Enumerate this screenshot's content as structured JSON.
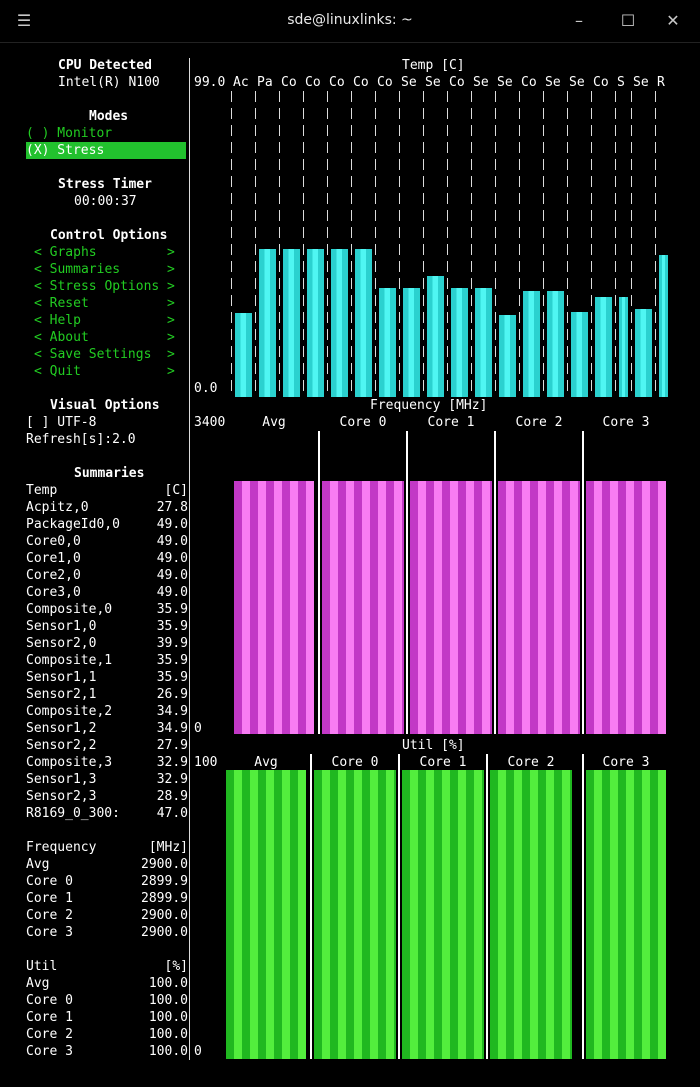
{
  "window": {
    "title": "sde@linuxlinks: ~",
    "menu_icon": "hamburger-icon",
    "min_icon": "minimize-icon",
    "max_icon": "maximize-icon",
    "close_icon": "close-icon"
  },
  "cpu": {
    "heading": "CPU Detected",
    "model": "Intel(R) N100"
  },
  "modes": {
    "heading": "Modes",
    "monitor": "( ) Monitor",
    "stress_mark": "(X)",
    "stress_label": " Stress"
  },
  "timer": {
    "heading": "Stress Timer",
    "value": "00:00:37"
  },
  "control": {
    "heading": "Control Options",
    "items": [
      "< Graphs         >",
      "< Summaries      >",
      "< Stress Options >",
      "< Reset          >",
      "< Help           >",
      "< About          >",
      "< Save Settings  >",
      "< Quit           >"
    ]
  },
  "visual": {
    "heading": "Visual Options",
    "encoding": "[ ] UTF-8",
    "refresh": "Refresh[s]:2.0"
  },
  "summaries": {
    "heading": "Summaries",
    "temp": {
      "header": "Temp",
      "unit": "[C]",
      "rows": [
        [
          "Acpitz,0",
          "27.8"
        ],
        [
          "PackageId0,0",
          "49.0"
        ],
        [
          "Core0,0",
          "49.0"
        ],
        [
          "Core1,0",
          "49.0"
        ],
        [
          "Core2,0",
          "49.0"
        ],
        [
          "Core3,0",
          "49.0"
        ],
        [
          "Composite,0",
          "35.9"
        ],
        [
          "Sensor1,0",
          "35.9"
        ],
        [
          "Sensor2,0",
          "39.9"
        ],
        [
          "Composite,1",
          "35.9"
        ],
        [
          "Sensor1,1",
          "35.9"
        ],
        [
          "Sensor2,1",
          "26.9"
        ],
        [
          "Composite,2",
          "34.9"
        ],
        [
          "Sensor1,2",
          "34.9"
        ],
        [
          "Sensor2,2",
          "27.9"
        ],
        [
          "Composite,3",
          "32.9"
        ],
        [
          "Sensor1,3",
          "32.9"
        ],
        [
          "Sensor2,3",
          "28.9"
        ],
        [
          "R8169_0_300:",
          "47.0"
        ]
      ]
    },
    "freq": {
      "header": "Frequency",
      "unit": "[MHz]",
      "rows": [
        [
          "Avg",
          "2900.0"
        ],
        [
          "Core 0",
          "2899.9"
        ],
        [
          "Core 1",
          "2899.9"
        ],
        [
          "Core 2",
          "2900.0"
        ],
        [
          "Core 3",
          "2900.0"
        ]
      ]
    },
    "util": {
      "header": "Util",
      "unit": "[%]",
      "rows": [
        [
          "Avg",
          "100.0"
        ],
        [
          "Core 0",
          "100.0"
        ],
        [
          "Core 1",
          "100.0"
        ],
        [
          "Core 2",
          "100.0"
        ],
        [
          "Core 3",
          "100.0"
        ]
      ]
    }
  },
  "temp_graph": {
    "title": "Temp [C]",
    "max": "99.0",
    "min": "0.0",
    "max_value": 99.0,
    "sensor_labels": [
      "Ac",
      "Pa",
      "Co",
      "Co",
      "Co",
      "Co",
      "Co",
      "Se",
      "Se",
      "Co",
      "Se",
      "Se",
      "Co",
      "Se",
      "Se",
      "Co",
      "S",
      "Se",
      "R"
    ],
    "values": [
      27.8,
      49.0,
      49.0,
      49.0,
      49.0,
      49.0,
      35.9,
      35.9,
      39.9,
      35.9,
      35.9,
      26.9,
      34.9,
      34.9,
      27.9,
      32.9,
      32.9,
      28.9,
      47.0
    ]
  },
  "freq_graph": {
    "title": "Frequency [MHz]",
    "max": "3400",
    "min": "0",
    "columns": [
      "Avg",
      "Core 0",
      "Core 1",
      "Core 2",
      "Core 3"
    ],
    "values": [
      2900.0,
      2899.9,
      2899.9,
      2900.0,
      2900.0
    ]
  },
  "util_graph": {
    "title": "Util [%]",
    "max": "100",
    "min": "0",
    "columns": [
      "Avg",
      "Core 0",
      "Core 1",
      "Core 2",
      "Core 3"
    ],
    "values": [
      100.0,
      100.0,
      100.0,
      100.0,
      100.0
    ]
  }
}
